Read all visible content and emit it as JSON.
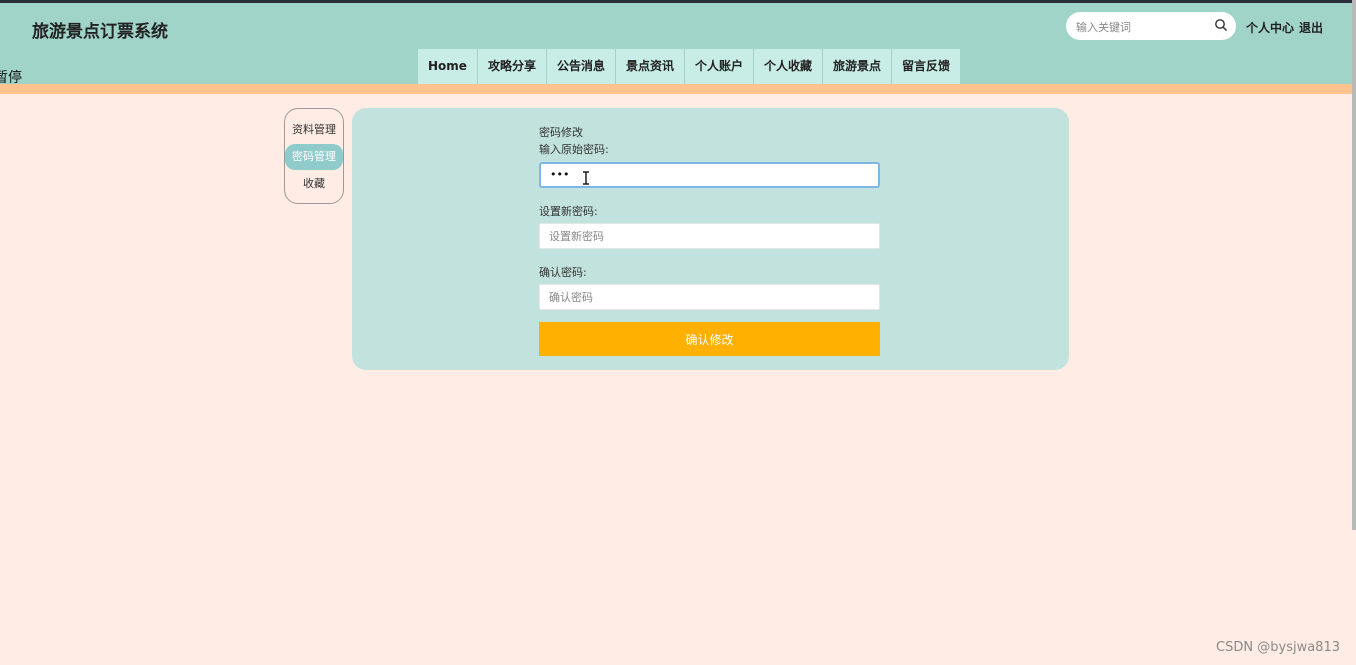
{
  "header": {
    "title": "旅游景点订票系统",
    "edge_text": "暂停",
    "search": {
      "placeholder": "输入关键词",
      "icon": "search-icon"
    },
    "links": {
      "personal_center": "个人中心",
      "logout": "退出"
    }
  },
  "nav": {
    "items": [
      {
        "label": "Home"
      },
      {
        "label": "攻略分享"
      },
      {
        "label": "公告消息"
      },
      {
        "label": "景点资讯"
      },
      {
        "label": "个人账户"
      },
      {
        "label": "个人收藏"
      },
      {
        "label": "旅游景点"
      },
      {
        "label": "留言反馈"
      }
    ]
  },
  "sidebar": {
    "items": [
      {
        "label": "资料管理",
        "active": false
      },
      {
        "label": "密码管理",
        "active": true
      },
      {
        "label": "收藏",
        "active": false
      }
    ]
  },
  "form": {
    "title": "密码修改",
    "old_password_label": "输入原始密码:",
    "old_password_value": "•••",
    "new_password_label": "设置新密码:",
    "new_password_placeholder": "设置新密码",
    "confirm_label": "确认密码:",
    "confirm_placeholder": "确认密码",
    "submit_label": "确认修改"
  },
  "watermark": "CSDN @bysjwa813",
  "colors": {
    "header_bg": "#a0d4c9",
    "nav_item_bg": "#c8ece6",
    "accent_bar": "#ffc38e",
    "page_bg": "#ffece5",
    "panel_bg": "#c2e2dd",
    "active_side": "#8fcbcb",
    "button": "#ffb000"
  }
}
